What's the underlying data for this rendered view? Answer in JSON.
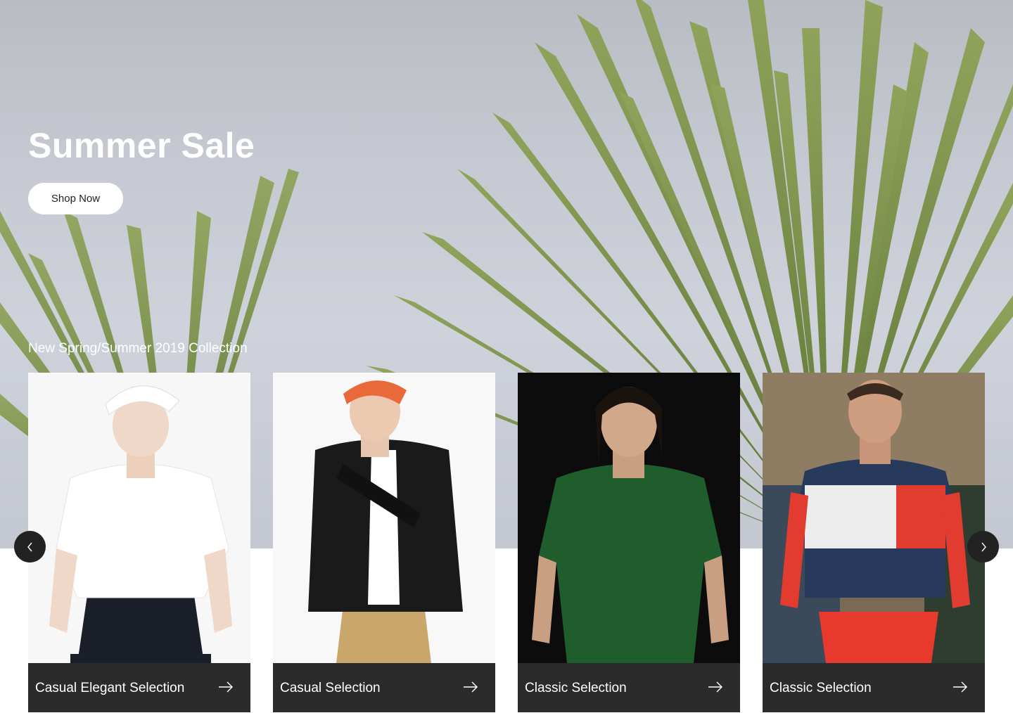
{
  "hero": {
    "title": "Summer Sale",
    "cta_label": "Shop Now",
    "collection_label": "New Spring/Summer 2019 Collection"
  },
  "cards": [
    {
      "label": "Casual Elegant Selection",
      "image": "model-white-polo-cap",
      "arrow_icon": "arrow-right-icon"
    },
    {
      "label": "Casual Selection",
      "image": "model-black-jacket-orange-cap",
      "arrow_icon": "arrow-right-icon"
    },
    {
      "label": "Classic Selection",
      "image": "model-green-polo",
      "arrow_icon": "arrow-right-icon"
    },
    {
      "label": "Classic Selection",
      "image": "model-tracksuit-red-white-navy",
      "arrow_icon": "arrow-right-icon"
    }
  ],
  "carousel": {
    "prev_icon": "chevron-left-icon",
    "next_icon": "chevron-right-icon"
  },
  "colors": {
    "card_footer": "#2b2b2b",
    "nav_button": "#222222",
    "palm_green": "#6f8a3c"
  }
}
